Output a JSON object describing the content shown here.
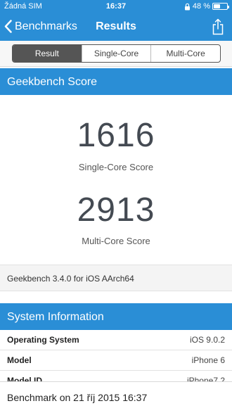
{
  "status_bar": {
    "carrier": "Žádná SIM",
    "time": "16:37",
    "battery_percent": "48 %",
    "battery_level": 0.48,
    "icons": [
      "lock-rotation-icon",
      "battery-icon"
    ]
  },
  "nav": {
    "back_label": "Benchmarks",
    "title": "Results",
    "share_icon": "share-icon"
  },
  "segments": {
    "items": [
      "Result",
      "Single-Core",
      "Multi-Core"
    ],
    "active": "Result"
  },
  "geekbench": {
    "header": "Geekbench Score",
    "single_score": "1616",
    "single_label": "Single-Core Score",
    "multi_score": "2913",
    "multi_label": "Multi-Core Score",
    "version": "Geekbench 3.4.0 for iOS AArch64"
  },
  "system_info": {
    "header": "System Information",
    "rows": [
      {
        "key": "Operating System",
        "value": "iOS 9.0.2"
      },
      {
        "key": "Model",
        "value": "iPhone 6"
      },
      {
        "key": "Model ID",
        "value": "iPhone7,2"
      }
    ]
  },
  "footer": {
    "text": "Benchmark on 21 říj 2015 16:37"
  },
  "colors": {
    "accent": "#2a8ed6",
    "segment_active": "#555555"
  }
}
